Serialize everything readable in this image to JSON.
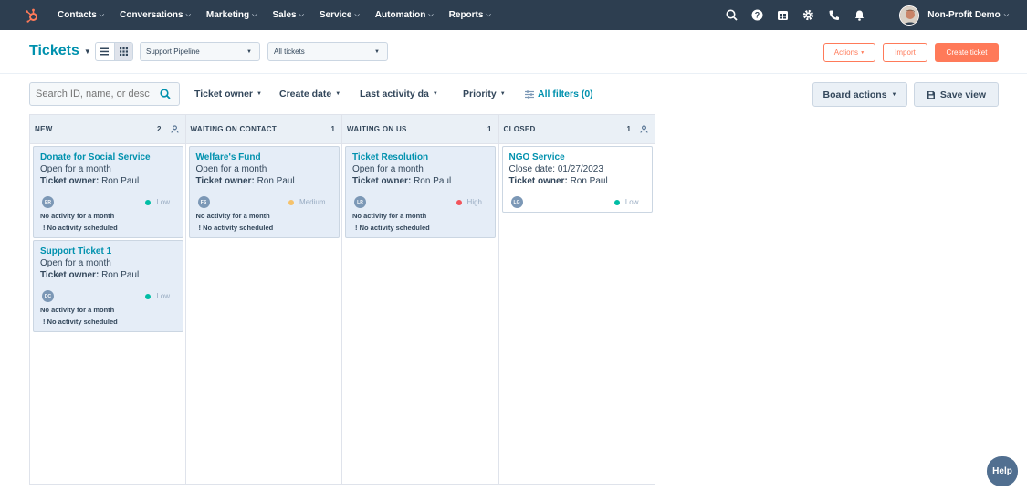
{
  "nav": {
    "logo_icon": "hubspot-sprocket-icon",
    "items": [
      {
        "label": "Contacts"
      },
      {
        "label": "Conversations"
      },
      {
        "label": "Marketing"
      },
      {
        "label": "Sales"
      },
      {
        "label": "Service"
      },
      {
        "label": "Automation"
      },
      {
        "label": "Reports"
      }
    ],
    "icons": [
      "search-icon",
      "help-circle-icon",
      "marketplace-icon",
      "settings-gear-icon",
      "calling-icon",
      "notifications-bell-icon"
    ],
    "account_name": "Non-Profit Demo"
  },
  "header": {
    "title": "Tickets",
    "pipeline_select": "Support Pipeline",
    "view_select": "All tickets",
    "actions_label": "Actions",
    "import_label": "Import",
    "create_label": "Create ticket"
  },
  "filters": {
    "search_placeholder": "Search ID, name, or desc",
    "ticket_owner": "Ticket owner",
    "create_date": "Create date",
    "last_activity": "Last activity da",
    "priority": "Priority",
    "all_filters": "All filters (0)",
    "board_actions": "Board actions",
    "save_view": "Save view"
  },
  "columns": [
    {
      "name": "NEW",
      "count": "2",
      "cards": [
        {
          "title": "Donate for Social Service",
          "line1": "Open for a month",
          "owner_label": "Ticket owner:",
          "owner": "Ron Paul",
          "initials": "ER",
          "priority": "Low",
          "priority_color": "#00bda5",
          "activity": "No activity for a month",
          "scheduled": "No activity scheduled"
        },
        {
          "title": "Support Ticket 1",
          "line1": "Open for a month",
          "owner_label": "Ticket owner:",
          "owner": "Ron Paul",
          "initials": "DC",
          "priority": "Low",
          "priority_color": "#00bda5",
          "activity": "No activity for a month",
          "scheduled": "No activity scheduled"
        }
      ]
    },
    {
      "name": "WAITING ON CONTACT",
      "count": "1",
      "cards": [
        {
          "title": "Welfare's Fund",
          "line1": "Open for a month",
          "owner_label": "Ticket owner:",
          "owner": "Ron Paul",
          "initials": "FS",
          "priority": "Medium",
          "priority_color": "#f5c26b",
          "activity": "No activity for a month",
          "scheduled": "No activity scheduled"
        }
      ]
    },
    {
      "name": "WAITING ON US",
      "count": "1",
      "cards": [
        {
          "title": "Ticket Resolution",
          "line1": "Open for a month",
          "owner_label": "Ticket owner:",
          "owner": "Ron Paul",
          "initials": "LR",
          "priority": "High",
          "priority_color": "#f2545b",
          "activity": "No activity for a month",
          "scheduled": "No activity scheduled"
        }
      ]
    },
    {
      "name": "CLOSED",
      "count": "1",
      "cards": [
        {
          "title": "NGO Service",
          "close_label": "Close date:",
          "close_date": "01/27/2023",
          "owner_label": "Ticket owner:",
          "owner": "Ron Paul",
          "initials": "LG",
          "priority": "Low",
          "priority_color": "#00bda5"
        }
      ]
    }
  ],
  "help_label": "Help",
  "colors": {
    "nav_bg": "#2d3e50",
    "accent_orange": "#ff7a59",
    "link_teal": "#0091ae",
    "card_bg": "#e5edf7"
  }
}
